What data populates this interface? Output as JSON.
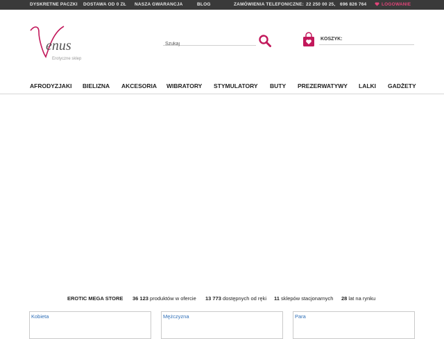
{
  "topbar": {
    "items": [
      "DYSKRETNE PACZKI",
      "DOSTAWA OD 0 ZŁ",
      "NASZA GWARANCJA",
      "BLOG"
    ],
    "phone_label": "ZAMÓWIENIA TELEFONICZNE:",
    "phone_1": "22 250 00 25,",
    "phone_2": "696 826 764",
    "login": "LOGOWANIE",
    "login_color": "#e3457a",
    "background": "#3a3a3a"
  },
  "header": {
    "logo_text": "Venus",
    "logo_tagline": "Erotyczne sklep",
    "search_placeholder": "Szukaj",
    "cart_label": "KOSZYK:",
    "brand_color": "#c2185b"
  },
  "nav": {
    "items": [
      "AFRODYZJAKI",
      "BIELIZNA",
      "AKCESORIA",
      "WIBRATORY",
      "STYMULATORY",
      "BUTY",
      "PREZERWATYWY",
      "LALKI",
      "GADŻETY"
    ]
  },
  "stats": {
    "title": "EROTIC MEGA STORE",
    "s1_num": "36 123",
    "s1_text": " produktów w ofercie",
    "s2_num": "13 773",
    "s2_text": " dostępnych od ręki",
    "s3_num": "11",
    "s3_text": " sklepów stacjonarnych",
    "s4_num": "28",
    "s4_text": " lat na rynku"
  },
  "categories": [
    "Kobieta",
    "Mężczyzna",
    "Para"
  ]
}
